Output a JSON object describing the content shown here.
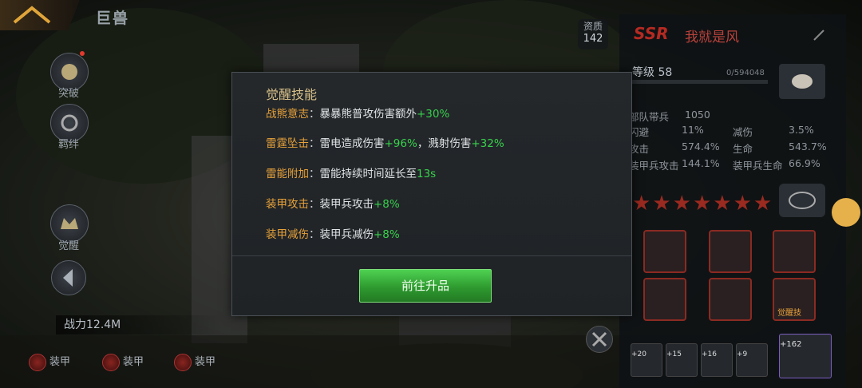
{
  "top": {
    "screen_title": "巨兽",
    "rank_label": "资质",
    "rank_value": "142"
  },
  "side": {
    "btn1_label": "突破",
    "btn2_label": "羁绊",
    "btn3_label": "觉醒"
  },
  "power_label": "战力12.4M",
  "armor_items": [
    "装甲",
    "装甲",
    "装甲"
  ],
  "panel": {
    "rarity": "SSR",
    "name": "我就是风",
    "level": "等级 58",
    "exp": "0/594048",
    "stats": [
      [
        "部队带兵",
        "1050",
        "",
        ""
      ],
      [
        "闪避",
        "11%",
        "减伤",
        "3.5%"
      ],
      [
        "攻击",
        "574.4%",
        "生命",
        "543.7%"
      ],
      [
        "装甲兵攻击",
        "144.1%",
        "装甲兵生命",
        "66.9%"
      ]
    ],
    "star_count": 7,
    "mini_levels": [
      "+20",
      "+15",
      "+16",
      "+9",
      "+162"
    ],
    "awaken_label": "觉醒技"
  },
  "dialog": {
    "title": "觉醒技能",
    "rows": [
      {
        "name": "战熊意志",
        "colon": "：",
        "parts": [
          [
            "暴暴熊普攻伤害额外",
            ""
          ],
          [
            "+30%",
            "g"
          ]
        ]
      },
      {
        "name": "雷霆坠击",
        "colon": "：",
        "parts": [
          [
            "雷电造成伤害",
            ""
          ],
          [
            "+96%",
            "g"
          ],
          [
            "，溅射伤害",
            ""
          ],
          [
            "+32%",
            "g"
          ]
        ]
      },
      {
        "name": "雷能附加",
        "colon": "：",
        "parts": [
          [
            "雷能持续时间延长至",
            ""
          ],
          [
            "13s",
            "g"
          ]
        ]
      },
      {
        "name": "装甲攻击",
        "colon": "：",
        "parts": [
          [
            "装甲兵攻击",
            ""
          ],
          [
            "+8%",
            "g"
          ]
        ]
      },
      {
        "name": "装甲减伤",
        "colon": "：",
        "parts": [
          [
            "装甲兵减伤",
            ""
          ],
          [
            "+8%",
            "g"
          ]
        ]
      }
    ],
    "button": "前往升品"
  },
  "colors": {
    "accent_gold": "#e7a13a",
    "buff_green": "#38d14c",
    "btn_green": "#2e9a2f",
    "ssr_red": "#b52a22"
  }
}
